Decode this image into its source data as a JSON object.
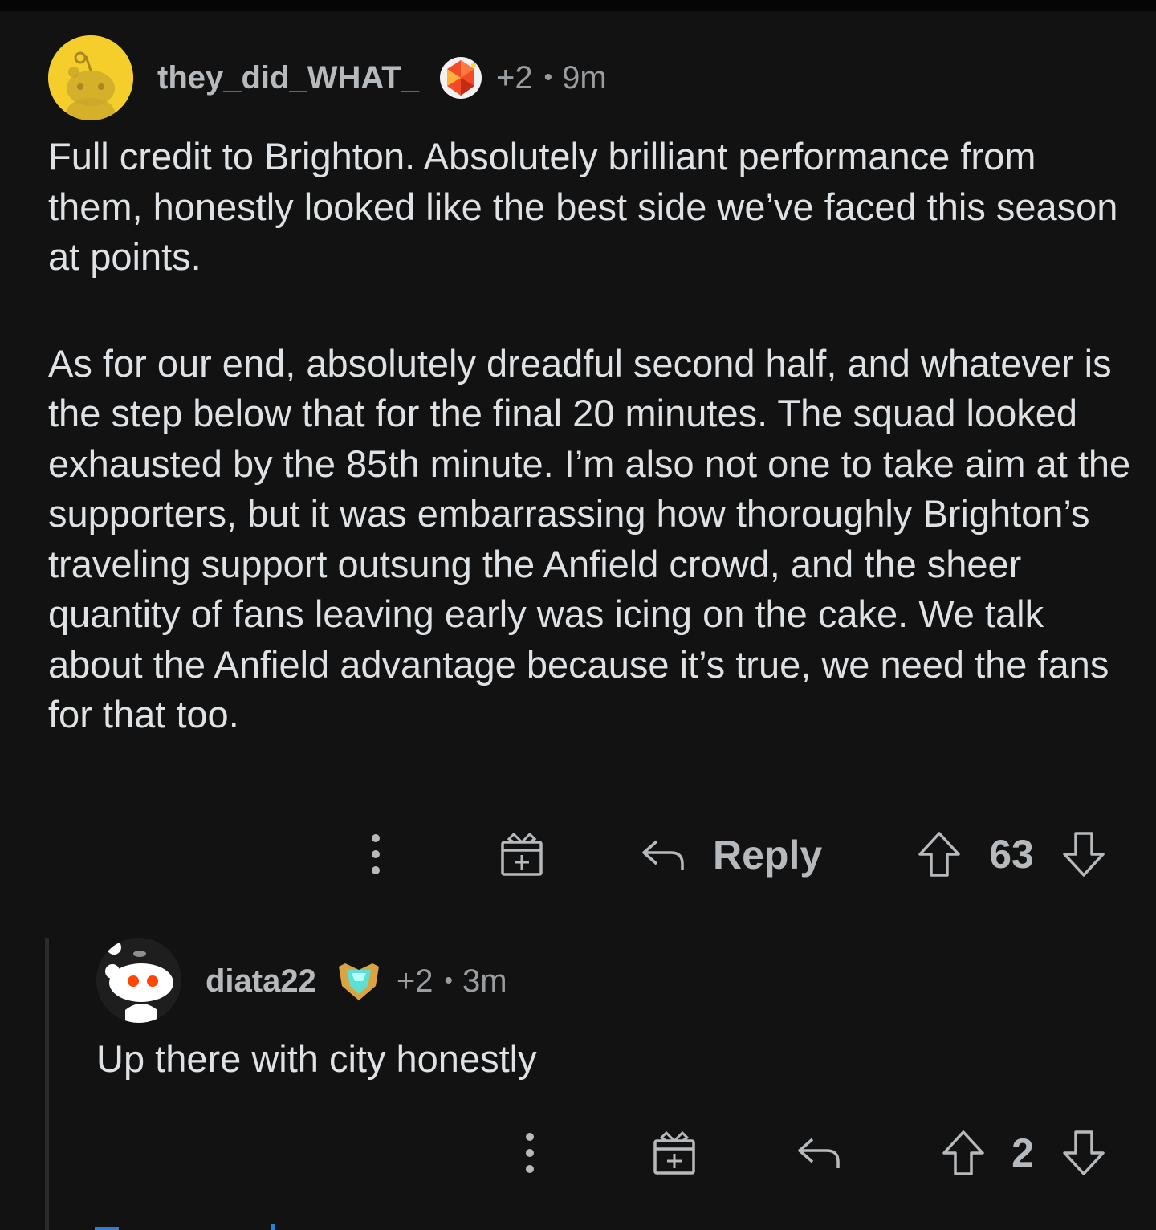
{
  "comments": [
    {
      "username": "they_did_WHAT_",
      "award_count": "+2",
      "separator": "•",
      "time": "9m",
      "paragraphs": [
        "Full credit to Brighton. Absolutely brilliant performance from them, honestly looked like the best side we’ve faced this season at points.",
        "As for our end, absolutely dreadful second half, and whatever is the step below that for the final 20 minutes. The squad looked exhausted by the 85th minute. I’m also not one to take aim at the supporters, but it was embarrassing how thoroughly Brighton’s traveling support outsung the Anfield crowd, and the sheer quantity of fans leaving early was icing on the cake. We talk about the Anfield advantage because it’s true, we need the fans for that too."
      ],
      "actions": {
        "reply_label": "Reply",
        "score": "63"
      },
      "icons": [
        "avatar-icon",
        "award-icon",
        "more-options-icon",
        "gift-award-icon",
        "reply-icon",
        "upvote-icon",
        "downvote-icon"
      ]
    },
    {
      "username": "diata22",
      "award_count": "+2",
      "separator": "•",
      "time": "3m",
      "paragraphs": [
        "Up there with city honestly"
      ],
      "actions": {
        "score": "2"
      },
      "icons": [
        "avatar-icon",
        "award-icon",
        "more-options-icon",
        "gift-award-icon",
        "reply-icon",
        "upvote-icon",
        "downvote-icon"
      ]
    }
  ],
  "colors": {
    "background": "#121212",
    "text": "#dfe2e4",
    "muted": "#9a9da0",
    "avatar_yellow": "#f6ce2c",
    "thread_line": "#2b2b2b",
    "link_blue": "#2e7ed6"
  }
}
